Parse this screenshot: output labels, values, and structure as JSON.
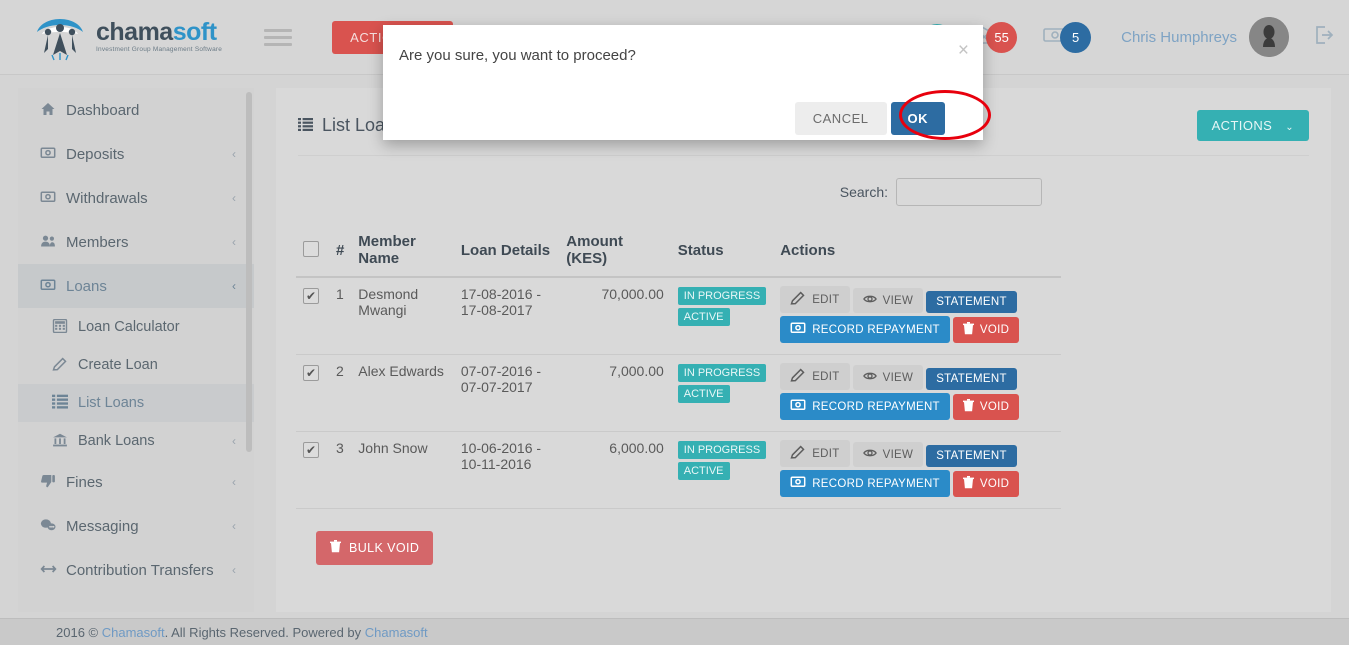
{
  "brand": {
    "name_part1": "chama",
    "name_part2": "soft",
    "tagline": "Investment Group Management Software",
    "logo_icon": "chamasoft-logo-icon"
  },
  "navbar": {
    "menu_toggle_icon": "hamburger-icon",
    "actions_label": "ACTIONS",
    "actions_caret": "⌄",
    "mail_icon": "envelope-icon",
    "mail_badge": "55",
    "money_icon": "banknote-icon",
    "money_badge": "5",
    "user_name": "Chris Humphreys",
    "avatar_icon": "user-avatar-icon",
    "logout_icon": "logout-icon",
    "colors": {
      "actions_red": "#d9534f",
      "badge_red": "#d9534f",
      "badge_blue": "#2d6ca2",
      "badge_teal": "#35b0b3"
    }
  },
  "sidebar": {
    "items": [
      {
        "label": "Dashboard",
        "icon": "home-icon",
        "caret": "",
        "active": false,
        "sub": false
      },
      {
        "label": "Deposits",
        "icon": "banknote-icon",
        "caret": "‹",
        "active": false,
        "sub": false
      },
      {
        "label": "Withdrawals",
        "icon": "banknote-icon",
        "caret": "‹",
        "active": false,
        "sub": false
      },
      {
        "label": "Members",
        "icon": "users-icon",
        "caret": "‹",
        "active": false,
        "sub": false
      },
      {
        "label": "Loans",
        "icon": "banknote-icon",
        "caret": "‹",
        "active": true,
        "sub": false
      },
      {
        "label": "Loan Calculator",
        "icon": "calculator-icon",
        "caret": "",
        "active": false,
        "sub": true
      },
      {
        "label": "Create Loan",
        "icon": "pencil-icon",
        "caret": "",
        "active": false,
        "sub": true
      },
      {
        "label": "List Loans",
        "icon": "list-icon",
        "caret": "",
        "active": true,
        "sub": true
      },
      {
        "label": "Bank Loans",
        "icon": "bank-icon",
        "caret": "‹",
        "active": false,
        "sub": true
      },
      {
        "label": "Fines",
        "icon": "thumbs-down-icon",
        "caret": "‹",
        "active": false,
        "sub": false
      },
      {
        "label": "Messaging",
        "icon": "chat-bubbles-icon",
        "caret": "‹",
        "active": false,
        "sub": false
      },
      {
        "label": "Contribution Transfers",
        "icon": "arrows-horizontal-icon",
        "caret": "‹",
        "active": false,
        "sub": false
      }
    ]
  },
  "content": {
    "page_title": "List Loan(s)",
    "page_title_icon": "list-icon",
    "actions_label": "ACTIONS",
    "actions_caret": "⌄",
    "search_label": "Search:",
    "search_value": "",
    "search_placeholder": "",
    "bulk_void_label": "BULK VOID",
    "bulk_void_icon": "trash-icon"
  },
  "table": {
    "select_all_checked": false,
    "columns": [
      "",
      "#",
      "Member Name",
      "Loan Details",
      "Amount (KES)",
      "Status",
      "Actions"
    ],
    "action_labels": {
      "edit": "EDIT",
      "view": "VIEW",
      "statement": "STATEMENT",
      "record_repayment": "RECORD REPAYMENT",
      "void": "VOID"
    },
    "action_icons": {
      "edit": "pencil-icon",
      "view": "eye-icon",
      "statement": "",
      "record_repayment": "banknote-icon",
      "void": "trash-icon"
    },
    "rows": [
      {
        "checked": true,
        "num": "1",
        "member_name": "Desmond Mwangi",
        "loan_details": "17-08-2016 - 17-08-2017",
        "amount": "70,000.00",
        "status_primary": "IN PROGRESS",
        "status_secondary": "ACTIVE"
      },
      {
        "checked": true,
        "num": "2",
        "member_name": "Alex Edwards",
        "loan_details": "07-07-2016 - 07-07-2017",
        "amount": "7,000.00",
        "status_primary": "IN PROGRESS",
        "status_secondary": "ACTIVE"
      },
      {
        "checked": true,
        "num": "3",
        "member_name": "John Snow",
        "loan_details": "10-06-2016 - 10-11-2016",
        "amount": "6,000.00",
        "status_primary": "IN PROGRESS",
        "status_secondary": "ACTIVE"
      }
    ]
  },
  "modal": {
    "message": "Are you sure, you want to proceed?",
    "close_icon": "close-icon",
    "cancel_label": "CANCEL",
    "ok_label": "OK",
    "ok_color": "#2d6ca2",
    "annotation_color": "#e8000d"
  },
  "footer": {
    "text_before": "2016 © ",
    "link1": "Chamasoft",
    "text_middle": ". All Rights Reserved. Powered by ",
    "link2": "Chamasoft"
  }
}
